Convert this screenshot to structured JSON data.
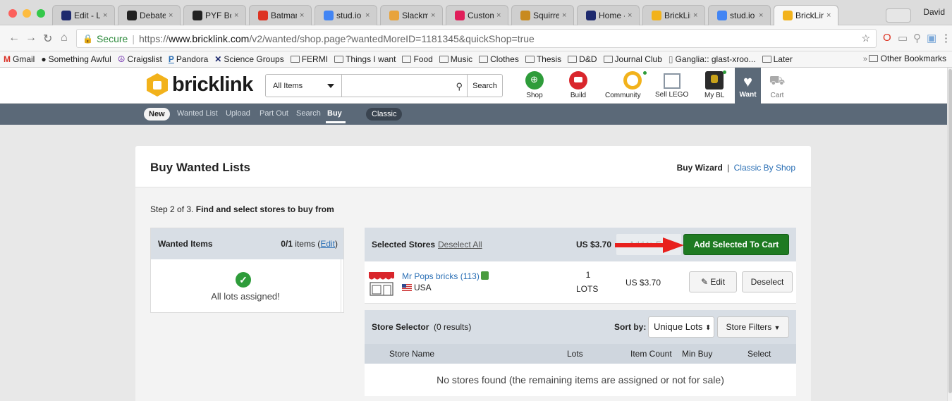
{
  "browser": {
    "tabs": [
      {
        "label": "Edit - Leg",
        "fav": "#1e2a6e"
      },
      {
        "label": "Debate &",
        "fav": "#222"
      },
      {
        "label": "PYF Bootl",
        "fav": "#222"
      },
      {
        "label": "Batman Fe",
        "fav": "#d32"
      },
      {
        "label": "stud.io mo",
        "fav": "#4285f4"
      },
      {
        "label": "Slackmoji",
        "fav": "#e8a33b"
      },
      {
        "label": "Custom E",
        "fav": "#e01e5a"
      },
      {
        "label": "Squirrels@",
        "fav": "#c88a1f"
      },
      {
        "label": "Home - Gl",
        "fav": "#1e2a6e"
      },
      {
        "label": "BrickLink",
        "fav": "#f2b21b"
      },
      {
        "label": "stud.io ex",
        "fav": "#4285f4"
      },
      {
        "label": "BrickLink",
        "fav": "#f2b21b",
        "active": true
      }
    ],
    "profile": "David",
    "secure_label": "Secure",
    "url_scheme": "https://",
    "url_host": "www.bricklink.com",
    "url_path": "/v2/wanted/shop.page?wantedMoreID=1181345&quickShop=true",
    "bookmarks": [
      {
        "label": "Gmail",
        "icon": "gmail-icon"
      },
      {
        "label": "Something Awful",
        "icon": "bomb-icon"
      },
      {
        "label": "Craigslist",
        "icon": "peace-icon"
      },
      {
        "label": "Pandora",
        "icon": "pandora-icon"
      },
      {
        "label": "Science Groups",
        "icon": "x-icon"
      },
      {
        "label": "FERMI",
        "icon": "folder-icon"
      },
      {
        "label": "Things I want",
        "icon": "folder-icon"
      },
      {
        "label": "Food",
        "icon": "folder-icon"
      },
      {
        "label": "Music",
        "icon": "folder-icon"
      },
      {
        "label": "Clothes",
        "icon": "folder-icon"
      },
      {
        "label": "Thesis",
        "icon": "folder-icon"
      },
      {
        "label": "D&D",
        "icon": "folder-icon"
      },
      {
        "label": "Journal Club",
        "icon": "folder-icon"
      },
      {
        "label": "Ganglia:: glast-xroo...",
        "icon": "page-icon"
      },
      {
        "label": "Later",
        "icon": "folder-icon"
      }
    ],
    "bookmarks_more": "»",
    "other_bookmarks": "Other Bookmarks"
  },
  "header": {
    "logo_text": "bricklink",
    "category": "All Items",
    "search_placeholder": "",
    "search_button": "Search",
    "nav": [
      {
        "label": "Shop",
        "color": "#2e9c3a"
      },
      {
        "label": "Build",
        "color": "#d9262c"
      },
      {
        "label": "Community",
        "color": "#f2b21b"
      },
      {
        "label": "Sell LEGO",
        "color": "#8a96a3"
      },
      {
        "label": "My BL",
        "color": "#2b2b2b"
      }
    ],
    "want_label": "Want",
    "cart_label": "Cart"
  },
  "subnav": {
    "new_badge": "New",
    "links": [
      "Wanted List",
      "Upload",
      "Part Out",
      "Search",
      "Buy"
    ],
    "active": "Buy",
    "classic": "Classic"
  },
  "page": {
    "title": "Buy Wanted Lists",
    "buy_wizard": "Buy Wizard",
    "link_sep": "|",
    "classic_by_shop": "Classic By Shop",
    "step_prefix": "Step 2 of 3.",
    "step_text": "Find and select stores to buy from"
  },
  "wanted": {
    "label": "Wanted Items",
    "count": "0/1",
    "items_word": "items",
    "edit_link": "Edit",
    "assigned_msg": "All lots assigned!"
  },
  "selected": {
    "label": "Selected Stores",
    "deselect_all": "Deselect All",
    "total": "US $3.70",
    "ghost_button": "Add to F...",
    "add_to_cart": "Add Selected To Cart",
    "accent": "#1e7a22",
    "arrow_color": "#e8201d"
  },
  "store": {
    "name": "Mr Pops bricks",
    "feedback": "(113)",
    "country": "USA",
    "lots": "1",
    "lots_label": "LOTS",
    "price": "US $3.70",
    "edit_button": "Edit",
    "deselect_button": "Deselect"
  },
  "selector": {
    "label": "Store Selector",
    "results": "(0 results)",
    "sort_label": "Sort by:",
    "sort_value": "Unique Lots",
    "filters": "Store Filters",
    "columns": [
      "Store Name",
      "Lots",
      "Item Count",
      "Min Buy",
      "Select"
    ],
    "empty": "No stores found (the remaining items are assigned or not for sale)"
  }
}
